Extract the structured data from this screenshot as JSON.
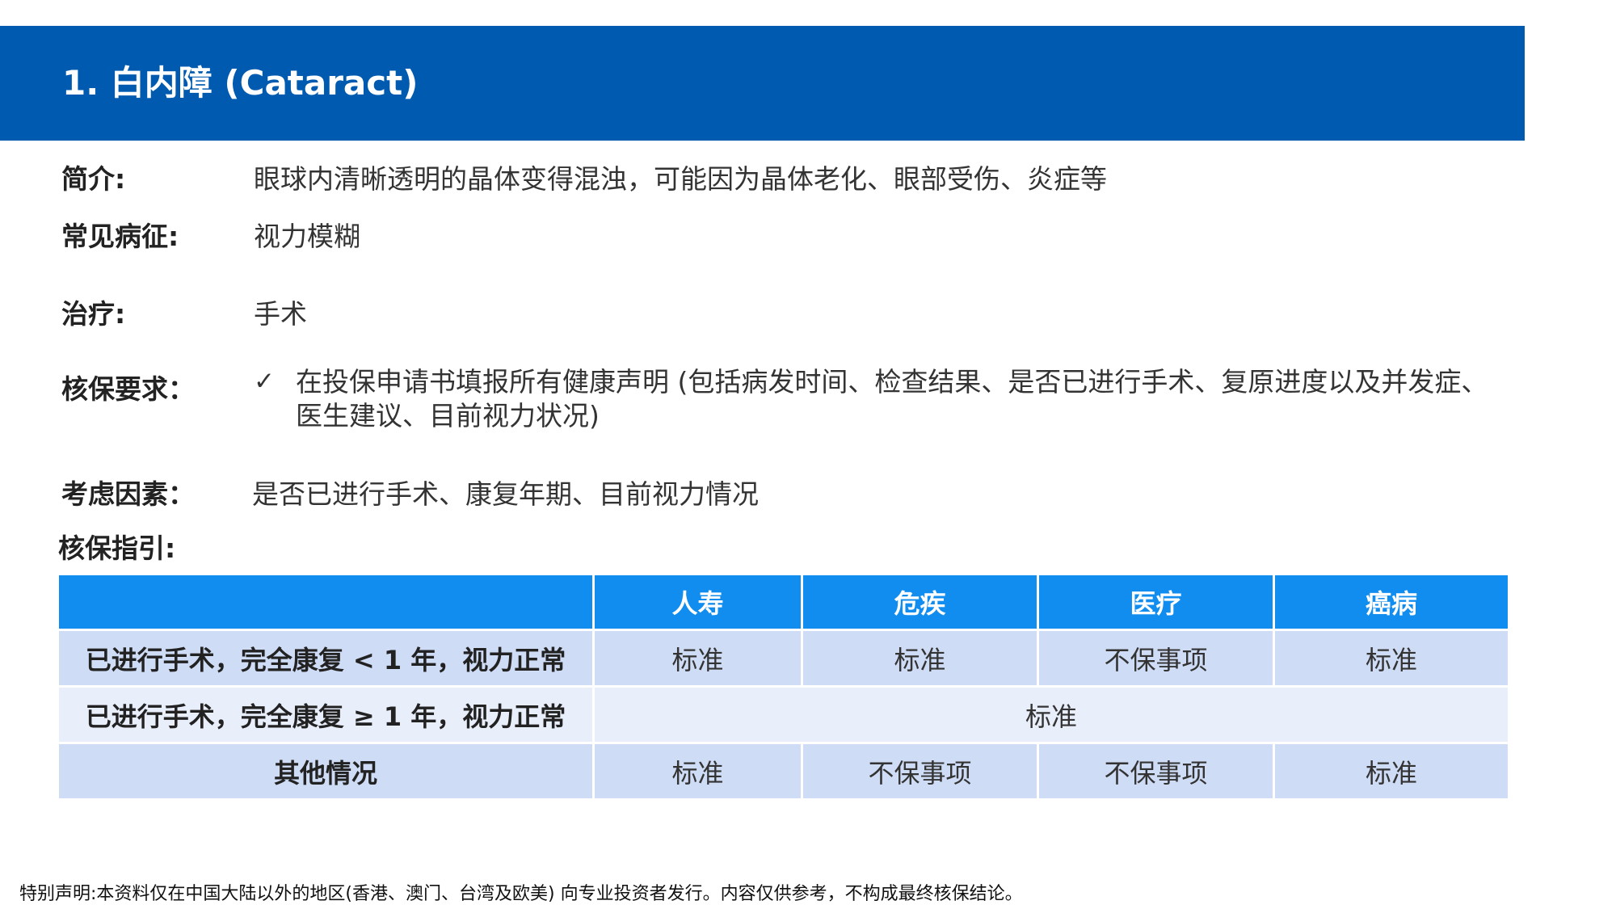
{
  "title": "1. 白内障 (Cataract)",
  "intro": {
    "label": "简介:",
    "value": "眼球内清晰透明的晶体变得混浊，可能因为晶体老化、眼部受伤、炎症等"
  },
  "symptoms": {
    "label": "常见病征:",
    "value": "视力模糊"
  },
  "treatment": {
    "label": "治疗:",
    "value": "手术"
  },
  "requirements": {
    "label": "核保要求：",
    "icon": "check-icon",
    "text": "在投保申请书填报所有健康声明 (包括病发时间、检查结果、是否已进行手术、复原进度以及并发症、医生建议、目前视力状况)"
  },
  "factors": {
    "label": "考虑因素：",
    "value": "是否已进行手术、康复年期、目前视力情况"
  },
  "guide_label": "核保指引:",
  "table": {
    "headers": [
      "",
      "人寿",
      "危疾",
      "医疗",
      "癌病"
    ],
    "rows": [
      {
        "condition": "已进行手术，完全康复 < 1 年，视力正常",
        "cells": [
          "标准",
          "标准",
          "不保事项",
          "标准"
        ]
      },
      {
        "condition": "已进行手术，完全康复 ≥ 1 年，视力正常",
        "merged": "标准"
      },
      {
        "condition": "其他情况",
        "cells": [
          "标准",
          "不保事项",
          "不保事项",
          "标准"
        ]
      }
    ]
  },
  "disclaimer": "特别声明:本资料仅在中国大陆以外的地区(香港、澳门、台湾及欧美) 向专业投资者发行。内容仅供参考，不构成最终核保结论。",
  "colors": {
    "title_bar": "#005bb0",
    "table_header": "#118df0",
    "row_dark": "#cfdcf5",
    "row_light": "#e9eefb"
  }
}
